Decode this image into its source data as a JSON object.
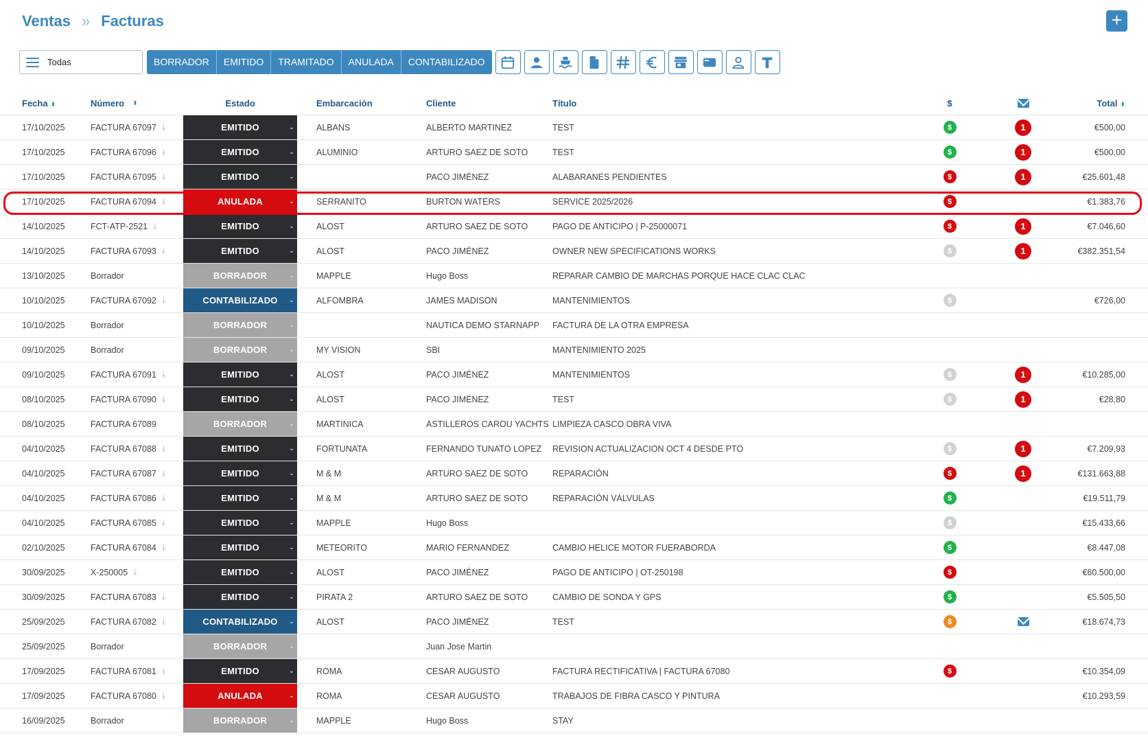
{
  "breadcrumb": {
    "parent": "Ventas",
    "separator": "»",
    "current": "Facturas"
  },
  "add_button": "+",
  "filter": {
    "value": "Todas"
  },
  "status_filters": [
    "BORRADOR",
    "EMITIDO",
    "TRAMITADO",
    "ANULADA",
    "CONTABILIZADO"
  ],
  "tool_icons": [
    "calendar-icon",
    "person-icon",
    "boat-icon",
    "document-icon",
    "hash-icon",
    "euro-icon",
    "store-icon",
    "card-icon",
    "user-outline-icon",
    "text-icon"
  ],
  "columns": {
    "fecha": "Fecha",
    "numero": "Número",
    "estado": "Estado",
    "embarcacion": "Embarcación",
    "cliente": "Cliente",
    "titulo": "Título",
    "dollar": "$",
    "total": "Total"
  },
  "rows": [
    {
      "fecha": "17/10/2025",
      "numero": "FACTURA 67097",
      "dl": true,
      "estado": "EMITIDO",
      "emb": "ALBANS",
      "cliente": "ALBERTO MARTINEZ",
      "titulo": "TEST",
      "pay": "green",
      "mail": "1",
      "total": "€500,00"
    },
    {
      "fecha": "17/10/2025",
      "numero": "FACTURA 67096",
      "dl": true,
      "estado": "EMITIDO",
      "emb": "ALUMINIO",
      "cliente": "ARTURO SAEZ DE SOTO",
      "titulo": "TEST",
      "pay": "green",
      "mail": "1",
      "total": "€500,00"
    },
    {
      "fecha": "17/10/2025",
      "numero": "FACTURA 67095",
      "dl": true,
      "estado": "EMITIDO",
      "emb": "",
      "cliente": "PACO JIMÉNEZ",
      "titulo": "ALABARANES PENDIENTES",
      "pay": "red",
      "mail": "1",
      "total": "€25.601,48"
    },
    {
      "fecha": "17/10/2025",
      "numero": "FACTURA 67094",
      "dl": true,
      "estado": "ANULADA",
      "emb": "SERRANITO",
      "cliente": "BURTON WATERS",
      "titulo": "SERVICE 2025/2026",
      "pay": "red",
      "mail": "",
      "total": "€1.383,76"
    },
    {
      "fecha": "14/10/2025",
      "numero": "FCT-ATP-2521",
      "dl": true,
      "estado": "EMITIDO",
      "emb": "ALOST",
      "cliente": "ARTURO SAEZ DE SOTO",
      "titulo": "PAGO DE ANTICIPO | P-25000071",
      "pay": "red",
      "mail": "1",
      "total": "€7.046,60"
    },
    {
      "fecha": "14/10/2025",
      "numero": "FACTURA 67093",
      "dl": true,
      "estado": "EMITIDO",
      "emb": "ALOST",
      "cliente": "PACO JIMÉNEZ",
      "titulo": "OWNER NEW SPECIFICATIONS WORKS",
      "pay": "grey",
      "mail": "1",
      "total": "€382.351,54"
    },
    {
      "fecha": "13/10/2025",
      "numero": "Borrador",
      "dl": false,
      "estado": "BORRADOR",
      "emb": "MAPPLE",
      "cliente": "Hugo Boss",
      "titulo": "REPARAR CAMBIO DE MARCHAS PORQUE HACE CLAC CLAC",
      "pay": "",
      "mail": "",
      "total": ""
    },
    {
      "fecha": "10/10/2025",
      "numero": "FACTURA 67092",
      "dl": true,
      "estado": "CONTABILIZADO",
      "emb": "ALFOMBRA",
      "cliente": "JAMES MADISON",
      "titulo": "MANTENIMIENTOS",
      "pay": "grey",
      "mail": "",
      "total": "€726,00"
    },
    {
      "fecha": "10/10/2025",
      "numero": "Borrador",
      "dl": false,
      "estado": "BORRADOR",
      "emb": "",
      "cliente": "NAUTICA DEMO STARNAPP",
      "titulo": "FACTURA DE LA OTRA EMPRESA",
      "pay": "",
      "mail": "",
      "total": ""
    },
    {
      "fecha": "09/10/2025",
      "numero": "Borrador",
      "dl": false,
      "estado": "BORRADOR",
      "emb": "MY VISION",
      "cliente": "SBI",
      "titulo": "MANTENIMIENTO 2025",
      "pay": "",
      "mail": "",
      "total": ""
    },
    {
      "fecha": "09/10/2025",
      "numero": "FACTURA 67091",
      "dl": true,
      "estado": "EMITIDO",
      "emb": "ALOST",
      "cliente": "PACO JIMÉNEZ",
      "titulo": "MANTENIMIENTOS",
      "pay": "grey",
      "mail": "1",
      "total": "€10.285,00"
    },
    {
      "fecha": "08/10/2025",
      "numero": "FACTURA 67090",
      "dl": true,
      "estado": "EMITIDO",
      "emb": "ALOST",
      "cliente": "PACO JIMÉNEZ",
      "titulo": "TEST",
      "pay": "grey",
      "mail": "1",
      "total": "€28,80"
    },
    {
      "fecha": "08/10/2025",
      "numero": "FACTURA 67089",
      "dl": false,
      "estado": "BORRADOR",
      "emb": "MARTINICA",
      "cliente": "ASTILLEROS CAROU YACHTS",
      "titulo": "LIMPIEZA CASCO OBRA VIVA",
      "pay": "",
      "mail": "",
      "total": ""
    },
    {
      "fecha": "04/10/2025",
      "numero": "FACTURA 67088",
      "dl": true,
      "estado": "EMITIDO",
      "emb": "FORTUNATA",
      "cliente": "FERNANDO TUNATO LOPEZ",
      "titulo": "REVISION ACTUALIZACION OCT 4 DESDE PTO",
      "pay": "grey",
      "mail": "1",
      "total": "€7.209,93"
    },
    {
      "fecha": "04/10/2025",
      "numero": "FACTURA 67087",
      "dl": true,
      "estado": "EMITIDO",
      "emb": "M & M",
      "cliente": "ARTURO SAEZ DE SOTO",
      "titulo": "REPARACIÓN",
      "pay": "red",
      "mail": "1",
      "total": "€131.663,88"
    },
    {
      "fecha": "04/10/2025",
      "numero": "FACTURA 67086",
      "dl": true,
      "estado": "EMITIDO",
      "emb": "M & M",
      "cliente": "ARTURO SAEZ DE SOTO",
      "titulo": "REPARACIÓN VÁLVULAS",
      "pay": "green",
      "mail": "",
      "total": "€19.511,79"
    },
    {
      "fecha": "04/10/2025",
      "numero": "FACTURA 67085",
      "dl": true,
      "estado": "EMITIDO",
      "emb": "MAPPLE",
      "cliente": "Hugo Boss",
      "titulo": "",
      "pay": "grey",
      "mail": "",
      "total": "€15.433,66"
    },
    {
      "fecha": "02/10/2025",
      "numero": "FACTURA 67084",
      "dl": true,
      "estado": "EMITIDO",
      "emb": "METEORITO",
      "cliente": "MARIO FERNANDEZ",
      "titulo": "CAMBIO HELICE MOTOR FUERABORDA",
      "pay": "green",
      "mail": "",
      "total": "€8.447,08"
    },
    {
      "fecha": "30/09/2025",
      "numero": "X-250005",
      "dl": true,
      "estado": "EMITIDO",
      "emb": "ALOST",
      "cliente": "PACO JIMÉNEZ",
      "titulo": "PAGO DE ANTICIPO | OT-250198",
      "pay": "red",
      "mail": "",
      "total": "€60.500,00"
    },
    {
      "fecha": "30/09/2025",
      "numero": "FACTURA 67083",
      "dl": true,
      "estado": "EMITIDO",
      "emb": "PIRATA 2",
      "cliente": "ARTURO SAEZ DE SOTO",
      "titulo": "CAMBIO DE SONDA Y GPS",
      "pay": "green",
      "mail": "",
      "total": "€5.505,50"
    },
    {
      "fecha": "25/09/2025",
      "numero": "FACTURA 67082",
      "dl": true,
      "estado": "CONTABILIZADO",
      "emb": "ALOST",
      "cliente": "PACO JIMÉNEZ",
      "titulo": "TEST",
      "pay": "orange",
      "mail": "envelope",
      "total": "€18.674,73"
    },
    {
      "fecha": "25/09/2025",
      "numero": "Borrador",
      "dl": false,
      "estado": "BORRADOR",
      "emb": "",
      "cliente": "Juan Jose Martin",
      "titulo": "",
      "pay": "",
      "mail": "",
      "total": ""
    },
    {
      "fecha": "17/09/2025",
      "numero": "FACTURA 67081",
      "dl": true,
      "estado": "EMITIDO",
      "emb": "ROMA",
      "cliente": "CESAR AUGUSTO",
      "titulo": "FACTURA RECTIFICATIVA | FACTURA 67080",
      "pay": "red",
      "mail": "",
      "total": "€10.354,09"
    },
    {
      "fecha": "17/09/2025",
      "numero": "FACTURA 67080",
      "dl": true,
      "estado": "ANULADA",
      "emb": "ROMA",
      "cliente": "CESAR AUGUSTO",
      "titulo": "TRABAJOS DE FIBRA CASCO Y PINTURA",
      "pay": "",
      "mail": "",
      "total": "€10.293,59"
    },
    {
      "fecha": "16/09/2025",
      "numero": "Borrador",
      "dl": false,
      "estado": "BORRADOR",
      "emb": "MAPPLE",
      "cliente": "Hugo Boss",
      "titulo": "STAY",
      "pay": "",
      "mail": "",
      "total": ""
    }
  ],
  "colors": {
    "accent": "#3d87bf",
    "emitido": "#2b2d30",
    "anulada": "#d40c10",
    "borrador": "#a6a6a6",
    "contabilizado": "#215a86"
  },
  "highlighted_row": 3
}
